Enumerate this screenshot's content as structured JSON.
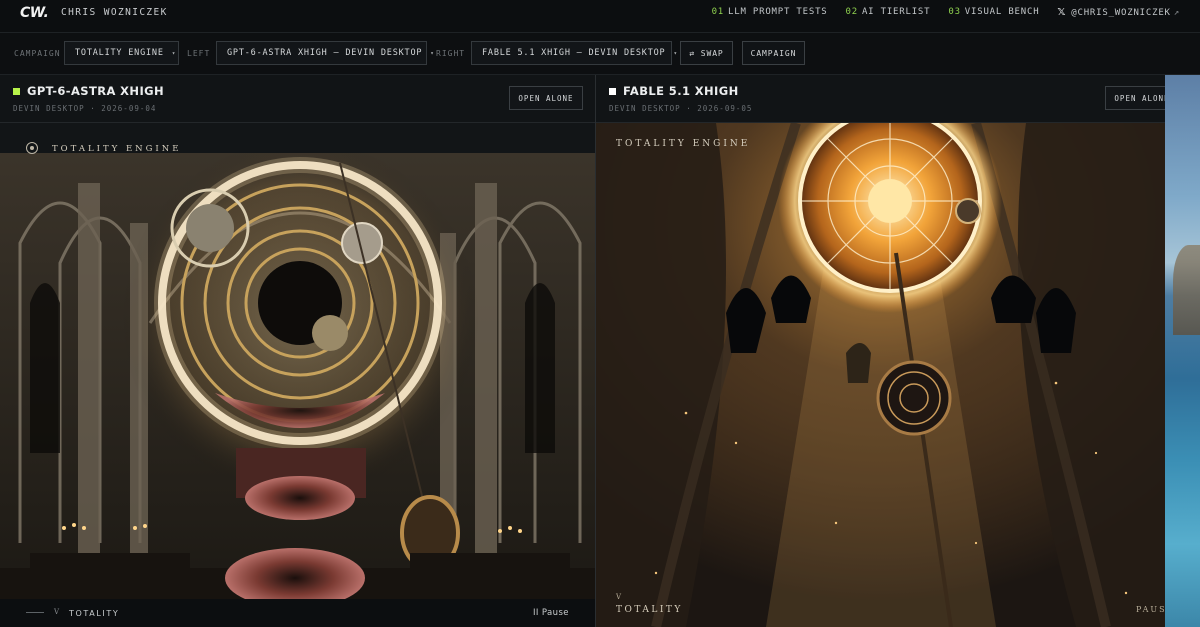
{
  "nav": {
    "logo": "CW.",
    "owner": "CHRIS WOZNICZEK",
    "links": [
      {
        "num": "01",
        "label": "LLM PROMPT TESTS"
      },
      {
        "num": "02",
        "label": "AI TIERLIST"
      },
      {
        "num": "03",
        "label": "VISUAL BENCH"
      }
    ],
    "social": {
      "icon": "x-logo-icon",
      "label": "@CHRIS_WOZNICZEK",
      "arrow": "↗"
    }
  },
  "toolbar": {
    "campaign_label": "CAMPAIGN",
    "campaign_value": "TOTALITY ENGINE",
    "left_label": "LEFT",
    "left_value": "GPT-6-ASTRA XHIGH — DEVIN DESKTOP",
    "right_label": "RIGHT",
    "right_value": "FABLE 5.1 XHIGH — DEVIN DESKTOP",
    "caret": "▾",
    "swap_label": "⇄ SWAP",
    "campaign_button": "CAMPAIGN"
  },
  "left_panel": {
    "title": "GPT-6-ASTRA XHIGH",
    "subtitle": "DEVIN DESKTOP · 2026-09-04",
    "open_button": "OPEN ALONE",
    "marker_color": "#b7f34a",
    "scene_title": "TOTALITY ENGINE",
    "bottom_small": "V",
    "bottom_label": "TOTALITY",
    "pause_label": "II  Pause"
  },
  "right_panel": {
    "title": "FABLE 5.1 XHIGH",
    "subtitle": "DEVIN DESKTOP · 2026-09-05",
    "open_button": "OPEN ALONE",
    "marker_color": "#ffffff",
    "scene_title": "TOTALITY ENGINE",
    "bottom_small": "V",
    "bottom_label": "TOTALITY",
    "pause_label": "PAUSE"
  },
  "colors": {
    "accent_green": "#8fd14f",
    "background": "#0b0d0f",
    "panel": "#121517"
  }
}
